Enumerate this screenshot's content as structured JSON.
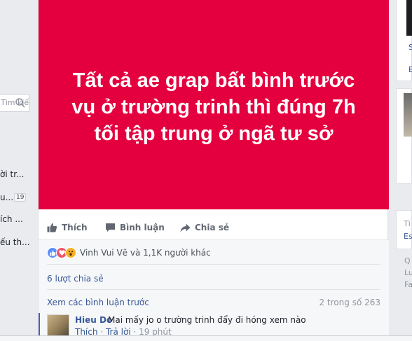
{
  "left_sidebar": {
    "search_placeholder": "Tìm kiế",
    "items": [
      "ời tr...",
      "u...",
      "ích ...",
      "ếu th..."
    ],
    "badge": "19"
  },
  "post": {
    "image_text": "Tất cả ae grap bất bình trước vụ ở trường trinh thì đúng 7h tối tập trung ở ngã tư sở",
    "image_bg_color": "#e4003f",
    "actions": {
      "like": "Thích",
      "comment": "Bình luận",
      "share": "Chia sẻ"
    },
    "reactions_text": "Vinh Vui Vẽ và 1,1K người khác",
    "shares_text": "6 lượt chia sẻ",
    "view_previous": "Xem các bình luận trước",
    "comment_count": "2 trong số 263",
    "comment": {
      "author": "Hieu Do",
      "text": "Mai mấy jo o trường trinh đẩy đi hóng xem nào",
      "like": "Thích",
      "reply": "Trả lời",
      "time": "19 phút"
    }
  },
  "right_sidebar": {
    "fragments": [
      "S",
      "E",
      "Tì",
      "Es",
      "Q",
      "Lu",
      "Fa"
    ]
  },
  "colors": {
    "link": "#385898",
    "accent": "#4267b2",
    "muted": "#90949c"
  }
}
